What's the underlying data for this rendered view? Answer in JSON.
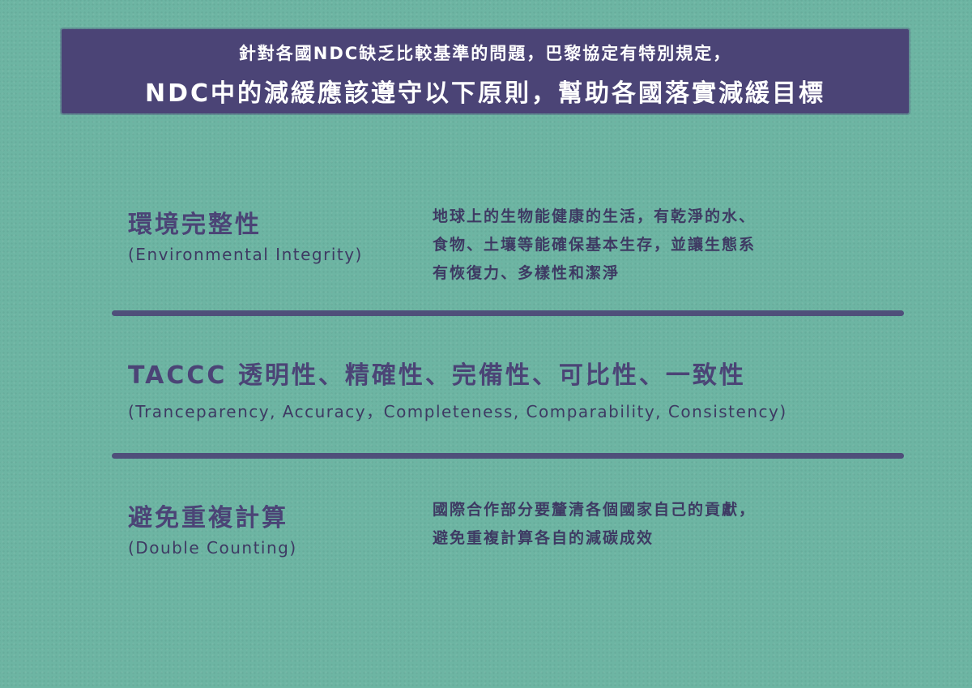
{
  "banner": {
    "line1": "針對各國NDC缺乏比較基準的問題，巴黎協定有特別規定，",
    "line2": "NDC中的減緩應該遵守以下原則，幫助各國落實減緩目標"
  },
  "sections": [
    {
      "title_zh": "環境完整性",
      "title_en": "(Environmental Integrity)",
      "description": [
        "地球上的生物能健康的生活，有乾淨的水、",
        "食物、土壤等能確保基本生存，並讓生態系",
        "有恢復力、多樣性和潔淨"
      ]
    },
    {
      "title_zh": "TACCC 透明性、精確性、完備性、可比性、一致性",
      "title_en": "(Tranceparency, Accuracy，Completeness, Comparability, Consistency)"
    },
    {
      "title_zh": "避免重複計算",
      "title_en": "(Double Counting)",
      "description": [
        "國際合作部分要釐清各個國家自己的貢獻，",
        "避免重複計算各自的減碳成效"
      ]
    }
  ],
  "colors": {
    "background": "#6db5a3",
    "accent": "#4b4476"
  }
}
